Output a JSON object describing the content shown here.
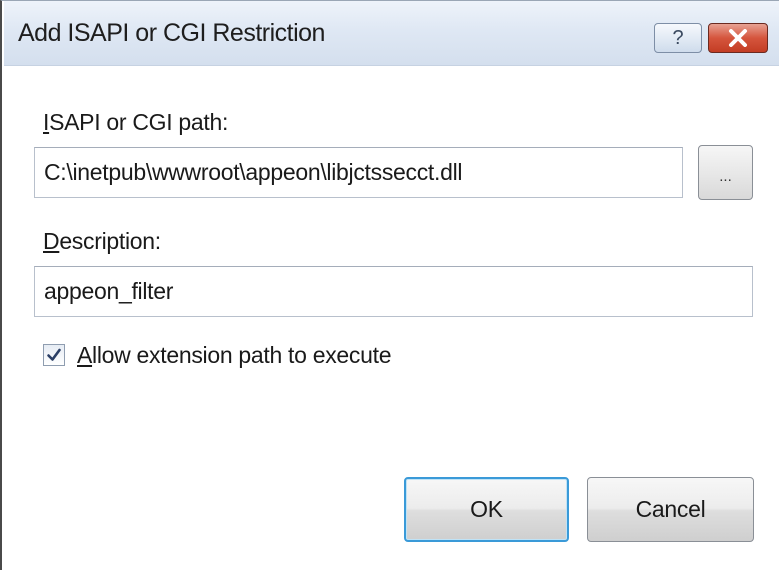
{
  "window": {
    "title": "Add ISAPI or CGI Restriction",
    "help_label": "?",
    "close_icon": "close-x-icon"
  },
  "form": {
    "path_label_access": "I",
    "path_label_rest": "SAPI or CGI path:",
    "path_value": "C:\\inetpub\\wwwroot\\appeon\\libjctssecct.dll",
    "browse_label": "...",
    "description_label_access": "D",
    "description_label_rest": "escription:",
    "description_value": "appeon_filter",
    "allow_checked": true,
    "allow_label_access": "A",
    "allow_label_rest": "llow extension path to execute"
  },
  "buttons": {
    "ok_label": "OK",
    "cancel_label": "Cancel"
  },
  "colors": {
    "title_bar": "#dfe8f4",
    "close_button": "#d5553d",
    "default_button_border": "#3a9ad8"
  }
}
